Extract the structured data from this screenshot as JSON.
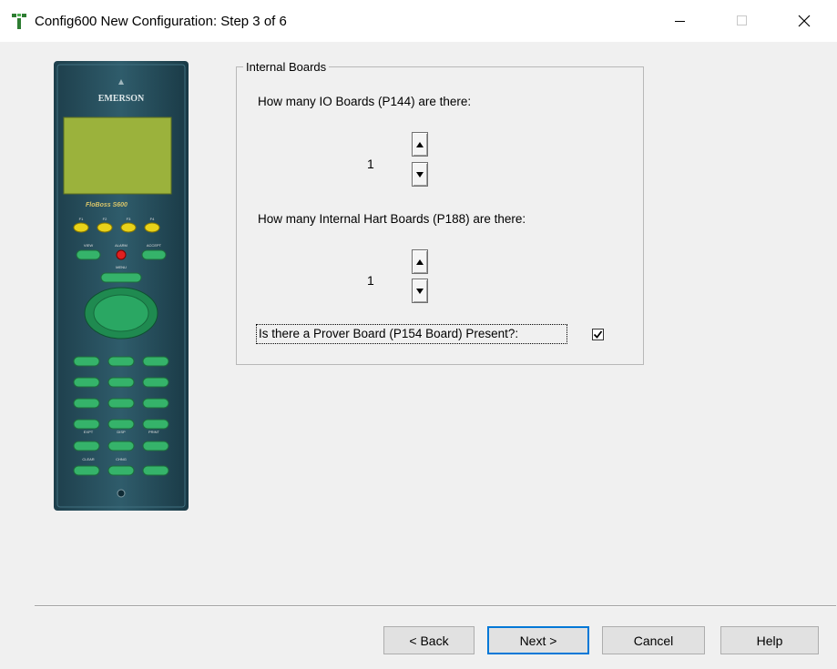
{
  "window": {
    "title": "Config600 New Configuration: Step 3 of 6",
    "controls": {
      "minimize": "minimize-icon",
      "maximize": "maximize-icon",
      "close": "close-icon"
    }
  },
  "device_image": {
    "brand": "EMERSON",
    "model": "FloBoss S600",
    "function_keys": [
      "F1",
      "F2",
      "F3",
      "F4"
    ],
    "key_labels": [
      "VIEW",
      "ALARM",
      "ACCEPT",
      "MENU",
      "EXPT",
      "DISP",
      "PRINT",
      "CLEAR",
      "CHNG"
    ]
  },
  "group": {
    "legend": "Internal Boards",
    "io_boards": {
      "question": "How many IO Boards (P144) are there:",
      "value": "1"
    },
    "hart_boards": {
      "question": "How many Internal Hart Boards (P188) are there:",
      "value": "1"
    },
    "prover": {
      "question": "Is there a Prover Board (P154 Board) Present?:",
      "checked": true
    }
  },
  "buttons": {
    "back": "< Back",
    "next": "Next >",
    "cancel": "Cancel",
    "help": "Help"
  }
}
